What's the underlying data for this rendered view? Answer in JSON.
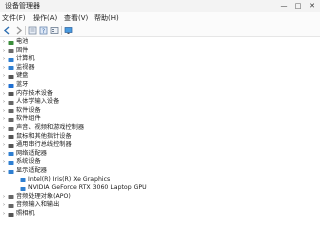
{
  "window": {
    "title": "设备管理器",
    "minimize": "—",
    "maximize": "□",
    "close": "✕"
  },
  "menu": {
    "file": "文件(F)",
    "action": "操作(A)",
    "view": "查看(V)",
    "help": "帮助(H)"
  },
  "toolbar": {
    "icons": [
      "back-icon",
      "forward-icon",
      "properties-icon",
      "help-icon",
      "view-icon",
      "monitor-icon"
    ]
  },
  "tree": {
    "root": "",
    "items": [
      {
        "label": "电池",
        "color": "#3a8d3a"
      },
      {
        "label": "固件",
        "color": "#6b6b6b"
      },
      {
        "label": "计算机",
        "color": "#2f7fd1"
      },
      {
        "label": "监视器",
        "color": "#2f7fd1"
      },
      {
        "label": "键盘",
        "color": "#555555"
      },
      {
        "label": "蓝牙",
        "color": "#1f6fd1"
      },
      {
        "label": "内存技术设备",
        "color": "#555555"
      },
      {
        "label": "人体学输入设备",
        "color": "#666666"
      },
      {
        "label": "软件设备",
        "color": "#666666"
      },
      {
        "label": "软件组件",
        "color": "#666666"
      },
      {
        "label": "声音、视频和游戏控制器",
        "color": "#666666"
      },
      {
        "label": "鼠标和其他指针设备",
        "color": "#555555"
      },
      {
        "label": "通用串行总线控制器",
        "color": "#555555"
      },
      {
        "label": "网络适配器",
        "color": "#2f7fd1"
      },
      {
        "label": "系统设备",
        "color": "#2f7fd1"
      },
      {
        "label": "显示适配器",
        "color": "#2f7fd1",
        "expanded": true
      },
      {
        "label": "Intel(R) Iris(R) Xe Graphics",
        "color": "#2f7fd1",
        "child": true
      },
      {
        "label": "NVIDIA GeForce RTX 3060 Laptop GPU",
        "color": "#2f7fd1",
        "child": true
      },
      {
        "label": "音频处理对象(APO)",
        "color": "#666666"
      },
      {
        "label": "音频输入和输出",
        "color": "#666666"
      },
      {
        "label": "照相机",
        "color": "#555555"
      }
    ]
  }
}
